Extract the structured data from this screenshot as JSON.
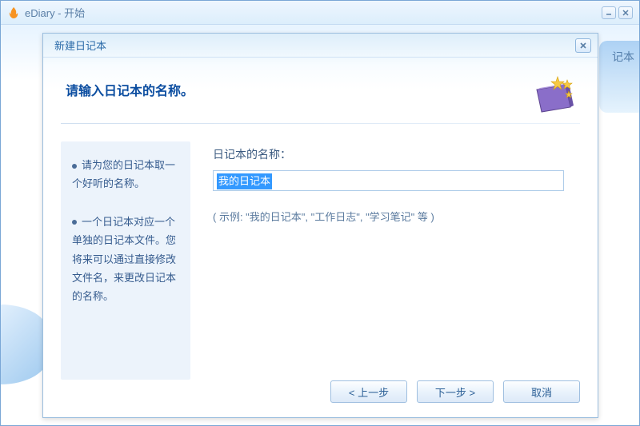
{
  "app": {
    "title": "eDiary - 开始",
    "bg_side_text": "记本"
  },
  "dialog": {
    "title": "新建日记本",
    "header": "请输入日记本的名称。",
    "sidebar": {
      "tip1": "请为您的日记本取一个好听的名称。",
      "tip2": "一个日记本对应一个单独的日记本文件。您将来可以通过直接修改文件名，来更改日记本的名称。"
    },
    "form": {
      "label": "日记本的名称：",
      "value": "我的日记本",
      "example": "( 示例: \"我的日记本\", \"工作日志\", \"学习笔记\" 等 )"
    },
    "buttons": {
      "prev": "< 上一步",
      "next": "下一步 >",
      "cancel": "取消"
    }
  },
  "icons": {
    "app": "app-flame-icon",
    "book": "diary-book-icon"
  }
}
